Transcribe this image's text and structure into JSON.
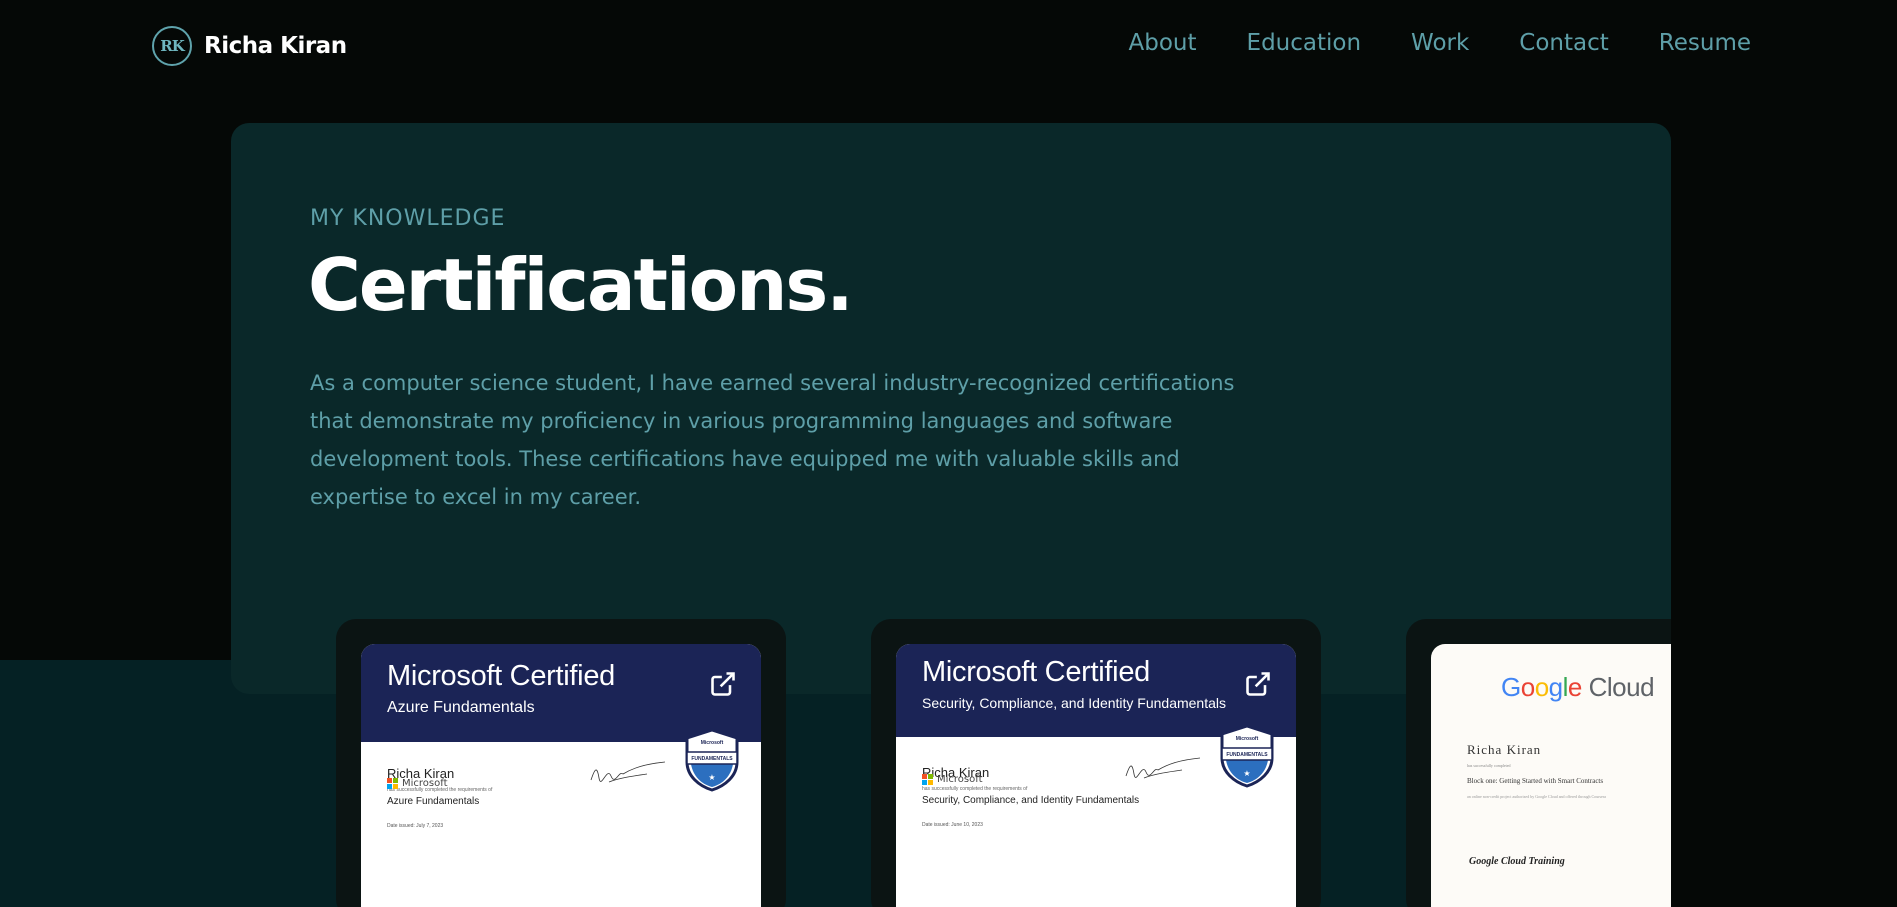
{
  "nav": {
    "logo_text": "RK",
    "brand_name": "Richa Kiran",
    "links": [
      "About",
      "Education",
      "Work",
      "Contact",
      "Resume"
    ]
  },
  "hero": {
    "eyebrow": "MY KNOWLEDGE",
    "title": "Certifications.",
    "description": "As a computer science student, I have earned several industry-recognized certifications that demonstrate my proficiency in various programming languages and software development tools. These certifications have equipped me with valuable skills and expertise to excel in my career."
  },
  "certificates": [
    {
      "brand": "Microsoft Certified",
      "subtitle": "Azure Fundamentals",
      "recipient": "Richa Kiran",
      "line": "has successfully completed the requirements of",
      "course": "Azure Fundamentals",
      "date": "Date issued: July 7, 2023",
      "issuer": "Microsoft",
      "badge_label": "FUNDAMENTALS"
    },
    {
      "brand": "Microsoft Certified",
      "subtitle": "Security, Compliance, and Identity Fundamentals",
      "recipient": "Richa Kiran",
      "line": "has successfully completed the requirements of",
      "course": "Security, Compliance, and Identity Fundamentals",
      "date": "Date issued: June 10, 2023",
      "issuer": "Microsoft",
      "badge_label": "FUNDAMENTALS"
    },
    {
      "brand_parts": [
        "G",
        "o",
        "o",
        "g",
        "l",
        "e"
      ],
      "brand_suffix": "Cloud",
      "recipient": "Richa Kiran",
      "line": "has successfully completed",
      "course": "Block one: Getting Started with Smart Contracts",
      "small": "an online non-credit project authorized by Google Cloud and offered through Coursera",
      "signature": "Google Cloud Training"
    }
  ],
  "colors": {
    "background": "#050806",
    "panel": "#0a2829",
    "accent": "#5e9fa8",
    "cert_header": "#1b2456"
  },
  "icons": {
    "external_link": "external-link-icon",
    "ms_logo": "microsoft-logo-icon"
  }
}
